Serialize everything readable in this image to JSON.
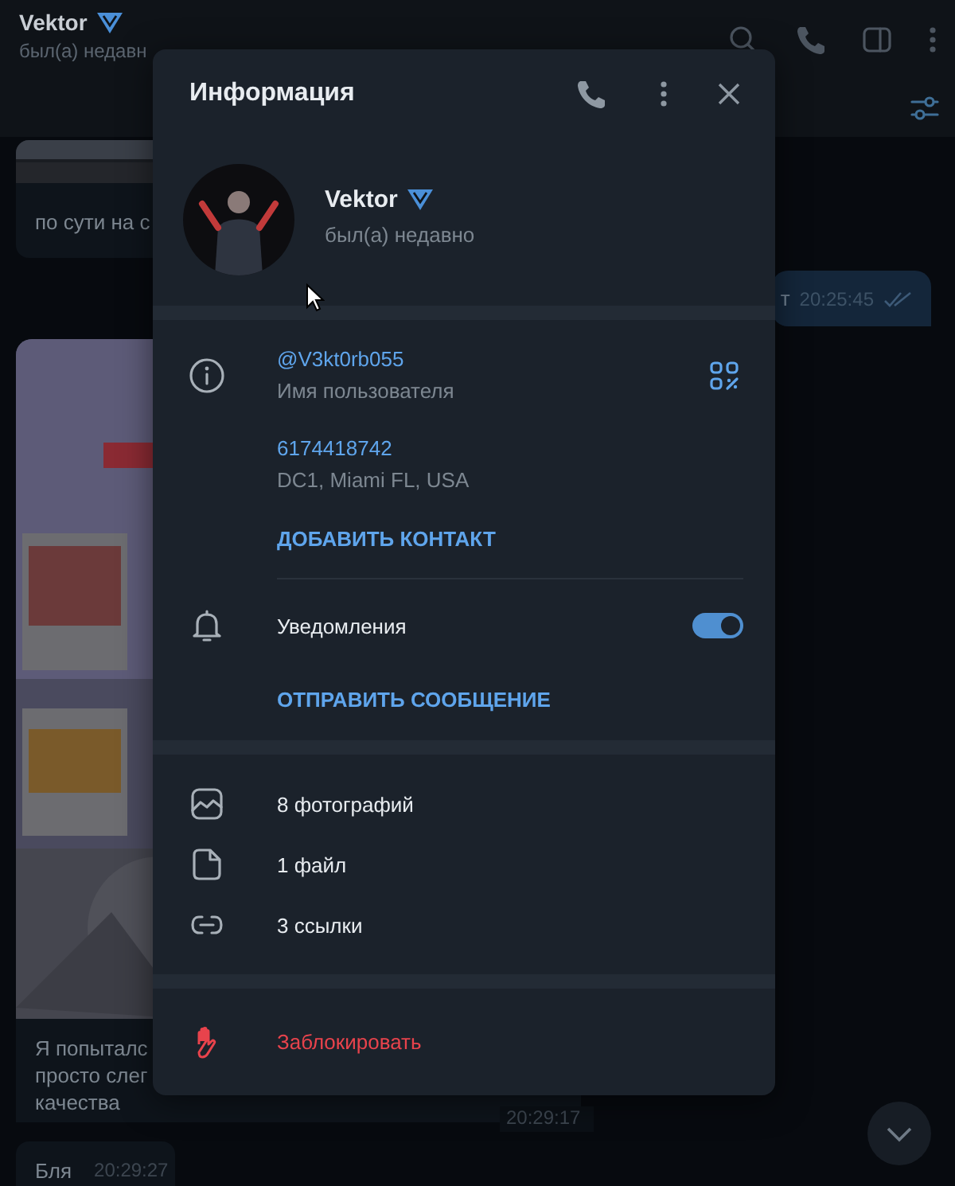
{
  "chat_header": {
    "name": "Vektor",
    "verified": true,
    "status": "был(а) недавн"
  },
  "messages": [
    {
      "kind": "preview",
      "text": "по сути на с"
    },
    {
      "kind": "outgoing",
      "text": "т",
      "time": "20:25:45",
      "read": true
    },
    {
      "text": "Я попыталс\nпросто слег\nкачества",
      "time": "20:29:17"
    },
    {
      "kind": "incoming",
      "text": "Бля",
      "time": "20:29:27"
    }
  ],
  "info_panel": {
    "title": "Информация",
    "profile": {
      "name": "Vektor",
      "verified": true,
      "status": "был(а) недавно"
    },
    "details": [
      {
        "value": "@V3kt0rb055",
        "label": "Имя пользователя",
        "qr": true
      },
      {
        "value": "6174418742",
        "label": "DC1, Miami FL, USA",
        "qr": false
      }
    ],
    "add_contact": "ДОБАВИТЬ КОНТАКТ",
    "notifications": {
      "label": "Уведомления",
      "on": true
    },
    "send_message": "ОТПРАВИТЬ СООБЩЕНИЕ",
    "media": [
      {
        "kind": "photos",
        "label": "8 фотографий"
      },
      {
        "kind": "files",
        "label": "1 файл"
      },
      {
        "kind": "links",
        "label": "3 ссылки"
      }
    ],
    "block": "Заблокировать"
  }
}
